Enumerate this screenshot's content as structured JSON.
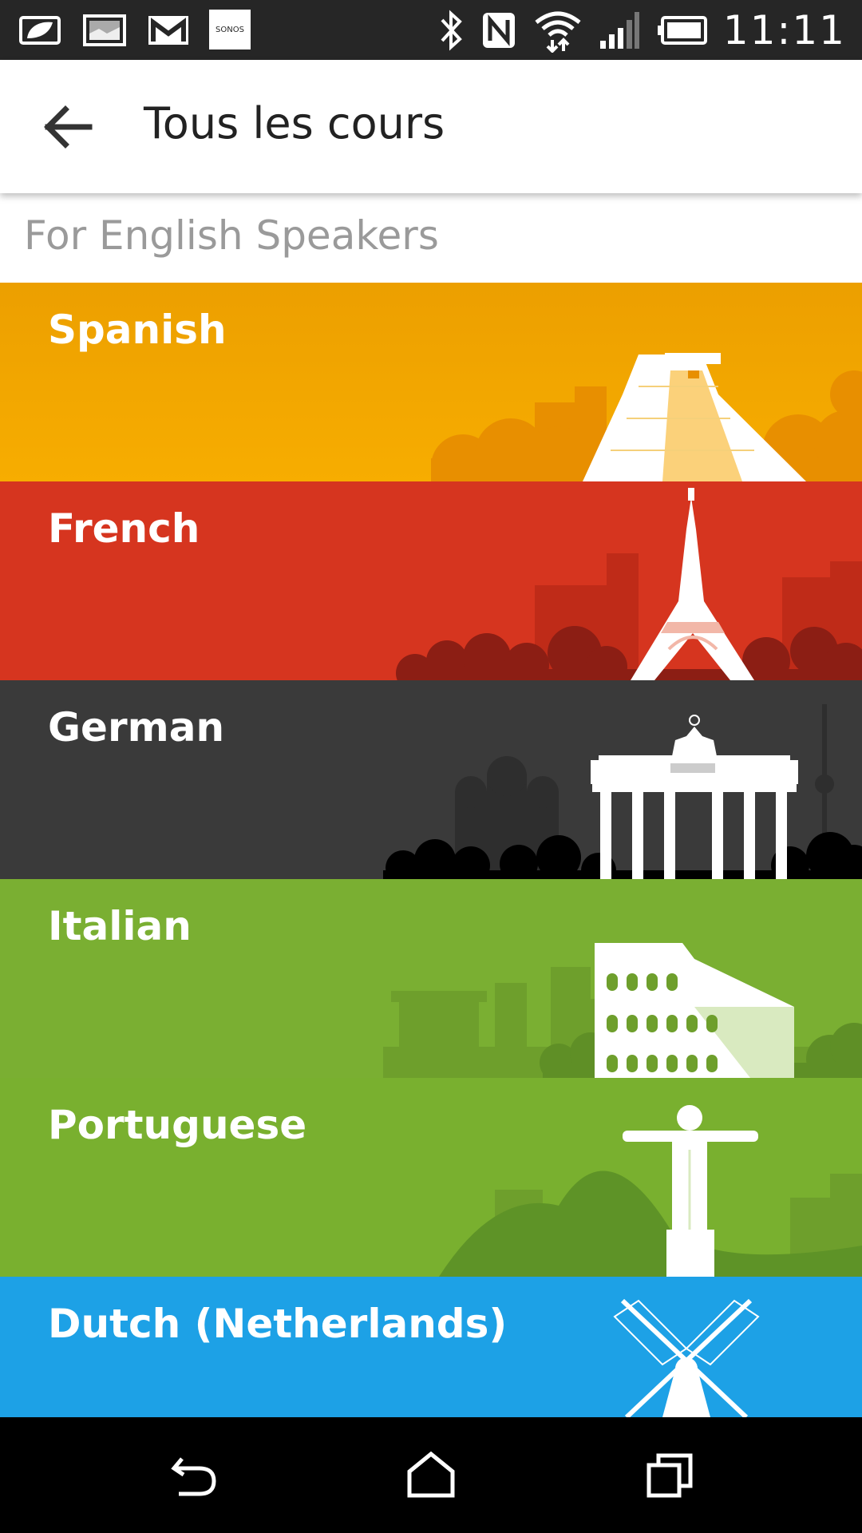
{
  "status_bar": {
    "left_icons": [
      "leaf-icon",
      "image-icon",
      "gmail-icon",
      "sonos-icon"
    ],
    "sonos_label": "SONOS",
    "right_icons": [
      "bluetooth-icon",
      "nfc-icon",
      "wifi-icon",
      "signal-icon",
      "battery-icon"
    ],
    "time": "11:11"
  },
  "app_bar": {
    "title": "Tous les cours",
    "back_icon": "arrow-back-icon"
  },
  "section": {
    "title": "For English Speakers"
  },
  "courses": [
    {
      "label": "Spanish",
      "color": "#F5A700",
      "icon": "pyramid-icon"
    },
    {
      "label": "French",
      "color": "#D6341E",
      "icon": "eiffel-tower-icon"
    },
    {
      "label": "German",
      "color": "#3A3A3A",
      "icon": "brandenburg-gate-icon"
    },
    {
      "label": "Italian",
      "color": "#7AAF32",
      "icon": "colosseum-icon"
    },
    {
      "label": "Portuguese",
      "color": "#79B02F",
      "icon": "christ-redeemer-icon"
    },
    {
      "label": "Dutch (Netherlands)",
      "color": "#1DA1E6",
      "icon": "windmill-icon"
    }
  ],
  "nav_bar": {
    "buttons": [
      "back-nav-icon",
      "home-nav-icon",
      "recents-nav-icon"
    ]
  }
}
